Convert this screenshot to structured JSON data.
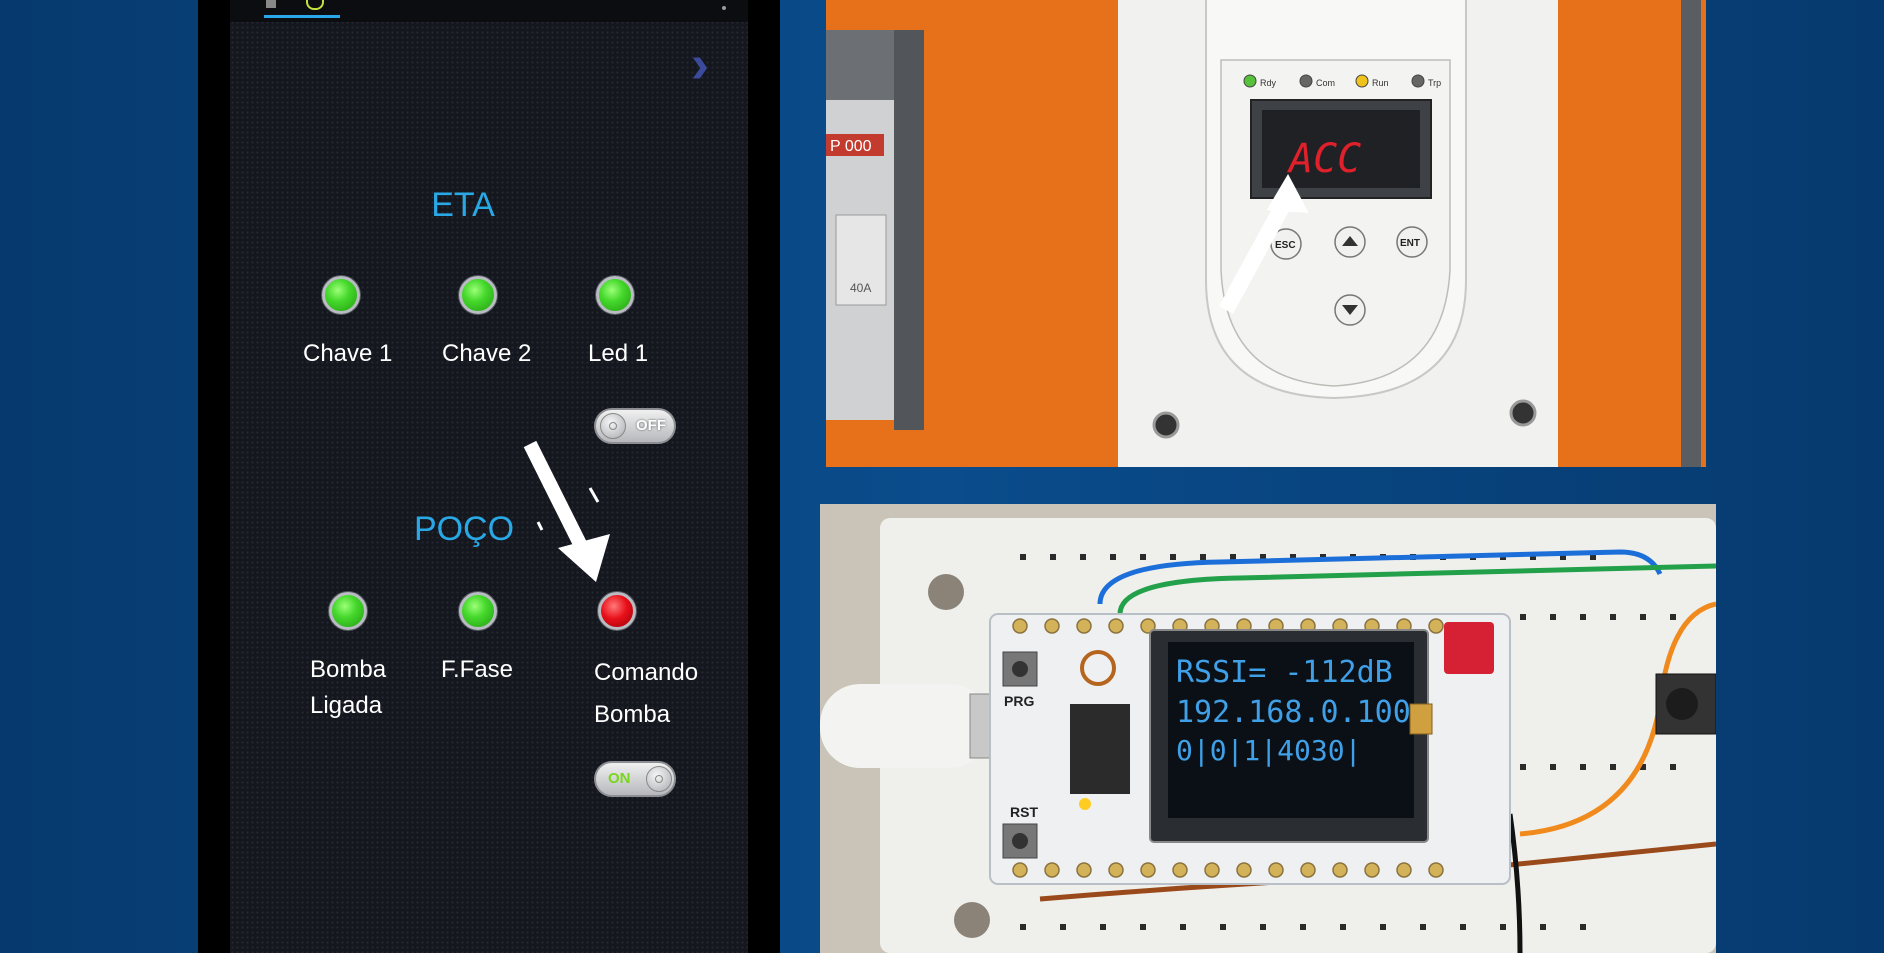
{
  "app": {
    "sections": [
      {
        "title": "ETA",
        "indicators": [
          {
            "label": "Chave 1",
            "state": "on",
            "color": "#3fd42a"
          },
          {
            "label": "Chave 2",
            "state": "on",
            "color": "#3fd42a"
          },
          {
            "label": "Led 1",
            "state": "on",
            "color": "#3fd42a"
          }
        ],
        "toggle": {
          "label": "OFF",
          "state": "off"
        }
      },
      {
        "title": "POÇO",
        "indicators": [
          {
            "label_line1": "Bomba",
            "label_line2": "Ligada",
            "state": "on",
            "color": "#3fd42a"
          },
          {
            "label": "F.Fase",
            "state": "on",
            "color": "#3fd42a"
          },
          {
            "label_line1": "Comando",
            "label_line2": "Bomba",
            "state": "on",
            "color": "#e8101a"
          }
        ],
        "toggle": {
          "label": "ON",
          "state": "on"
        }
      }
    ],
    "nav": {
      "next_icon": "chevron-right-icon"
    }
  },
  "photos": {
    "soft_starter": {
      "display_text": "ACC",
      "status_leds": [
        "Rdy",
        "Com",
        "Run",
        "Trp"
      ],
      "keys": [
        "ESC",
        "ENT"
      ],
      "breaker_label": "P 000",
      "breaker_rating": "40A"
    },
    "lora_board": {
      "oled_lines": [
        "RSSI= -112dB",
        "192.168.0.100",
        "0|0|1|4030|"
      ],
      "buttons": [
        "PRG",
        "RST"
      ]
    }
  },
  "colors": {
    "accent_title": "#29a8e6",
    "led_green": "#3fd42a",
    "led_red": "#e8101a",
    "background": "#0a4c8c"
  }
}
